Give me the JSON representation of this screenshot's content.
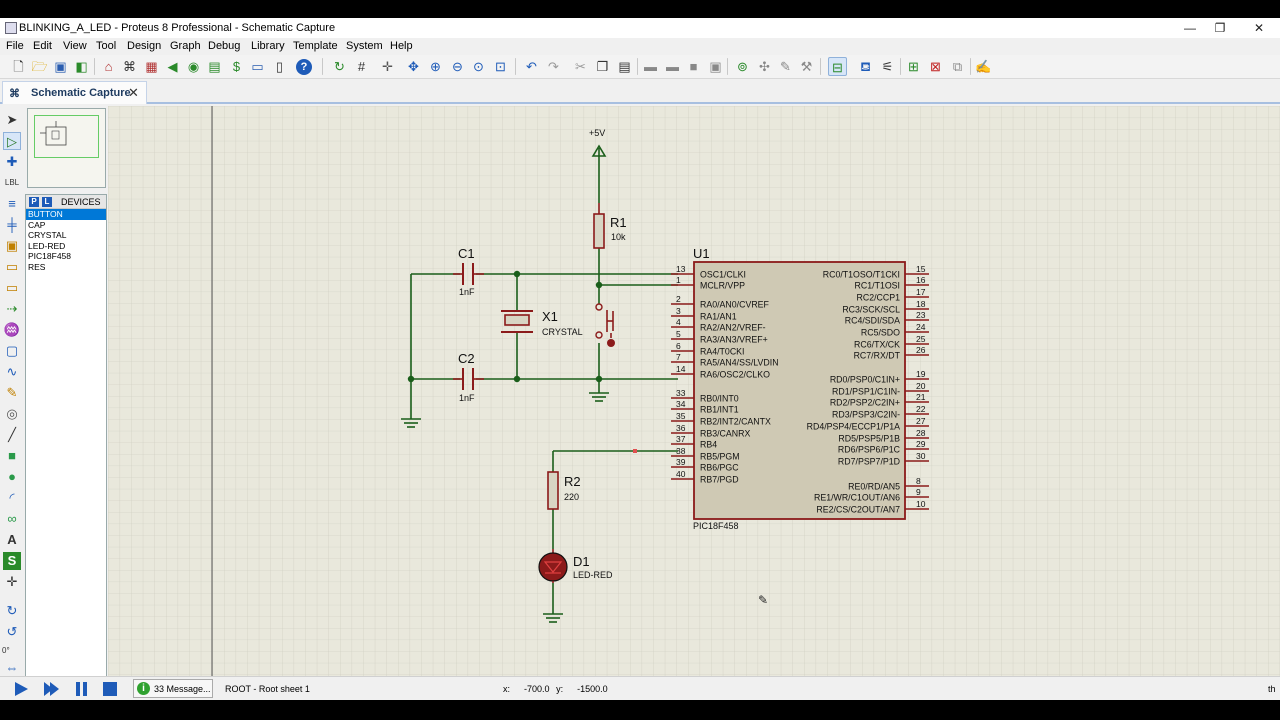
{
  "window": {
    "title": "BLINKING_A_LED - Proteus 8 Professional - Schematic Capture",
    "controls": {
      "minimize": "—",
      "maximize": "❐",
      "close": "✕"
    }
  },
  "menu": [
    "File",
    "Edit",
    "View",
    "Tool",
    "Design",
    "Graph",
    "Debug",
    "Library",
    "Template",
    "System",
    "Help"
  ],
  "tab": {
    "label": "Schematic Capture",
    "close": "✕"
  },
  "devices": {
    "header": "DEVICES",
    "p_button": "P",
    "l_button": "L",
    "items": [
      "BUTTON",
      "CAP",
      "CRYSTAL",
      "LED-RED",
      "PIC18F458",
      "RES"
    ],
    "selected": "BUTTON"
  },
  "rotation": "0°",
  "schematic": {
    "power": {
      "label": "+5V"
    },
    "r1": {
      "ref": "R1",
      "value": "10k"
    },
    "r2": {
      "ref": "R2",
      "value": "220"
    },
    "c1": {
      "ref": "C1",
      "value": "1nF"
    },
    "c2": {
      "ref": "C2",
      "value": "1nF"
    },
    "x1": {
      "ref": "X1",
      "value": "CRYSTAL"
    },
    "d1": {
      "ref": "D1",
      "value": "LED-RED"
    },
    "u1": {
      "ref": "U1",
      "part": "PIC18F458",
      "left_pins": [
        {
          "num": "13",
          "name": "OSC1/CLKI"
        },
        {
          "num": "1",
          "name": "MCLR/VPP"
        },
        {
          "num": "2",
          "name": "RA0/AN0/CVREF"
        },
        {
          "num": "3",
          "name": "RA1/AN1"
        },
        {
          "num": "4",
          "name": "RA2/AN2/VREF-"
        },
        {
          "num": "5",
          "name": "RA3/AN3/VREF+"
        },
        {
          "num": "6",
          "name": "RA4/T0CKI"
        },
        {
          "num": "7",
          "name": "RA5/AN4/SS/LVDIN"
        },
        {
          "num": "14",
          "name": "RA6/OSC2/CLKO"
        },
        {
          "num": "33",
          "name": "RB0/INT0"
        },
        {
          "num": "34",
          "name": "RB1/INT1"
        },
        {
          "num": "35",
          "name": "RB2/INT2/CANTX"
        },
        {
          "num": "36",
          "name": "RB3/CANRX"
        },
        {
          "num": "37",
          "name": "RB4"
        },
        {
          "num": "38",
          "name": "RB5/PGM"
        },
        {
          "num": "39",
          "name": "RB6/PGC"
        },
        {
          "num": "40",
          "name": "RB7/PGD"
        }
      ],
      "right_pins": [
        {
          "num": "15",
          "name": "RC0/T1OSO/T1CKI"
        },
        {
          "num": "16",
          "name": "RC1/T1OSI"
        },
        {
          "num": "17",
          "name": "RC2/CCP1"
        },
        {
          "num": "18",
          "name": "RC3/SCK/SCL"
        },
        {
          "num": "23",
          "name": "RC4/SDI/SDA"
        },
        {
          "num": "24",
          "name": "RC5/SDO"
        },
        {
          "num": "25",
          "name": "RC6/TX/CK"
        },
        {
          "num": "26",
          "name": "RC7/RX/DT"
        },
        {
          "num": "19",
          "name": "RD0/PSP0/C1IN+"
        },
        {
          "num": "20",
          "name": "RD1/PSP1/C1IN-"
        },
        {
          "num": "21",
          "name": "RD2/PSP2/C2IN+"
        },
        {
          "num": "22",
          "name": "RD3/PSP3/C2IN-"
        },
        {
          "num": "27",
          "name": "RD4/PSP4/ECCP1/P1A"
        },
        {
          "num": "28",
          "name": "RD5/PSP5/P1B"
        },
        {
          "num": "29",
          "name": "RD6/PSP6/P1C"
        },
        {
          "num": "30",
          "name": "RD7/PSP7/P1D"
        },
        {
          "num": "8",
          "name": "RE0/RD/AN5"
        },
        {
          "num": "9",
          "name": "RE1/WR/C1OUT/AN6"
        },
        {
          "num": "10",
          "name": "RE2/CS/C2OUT/AN7"
        }
      ]
    }
  },
  "status": {
    "messages": "33 Message...",
    "sheet": "ROOT - Root sheet 1",
    "x_label": "x:",
    "x_value": "-700.0",
    "y_label": "y:",
    "y_value": "-1500.0",
    "trailing": "th"
  },
  "colors": {
    "wire": "#1a5e1a",
    "component": "#8b1a1a",
    "chip_fill": "#cfc9b4",
    "grid": "#c9c9bd",
    "canvas_bg": "#e9e8dc"
  }
}
